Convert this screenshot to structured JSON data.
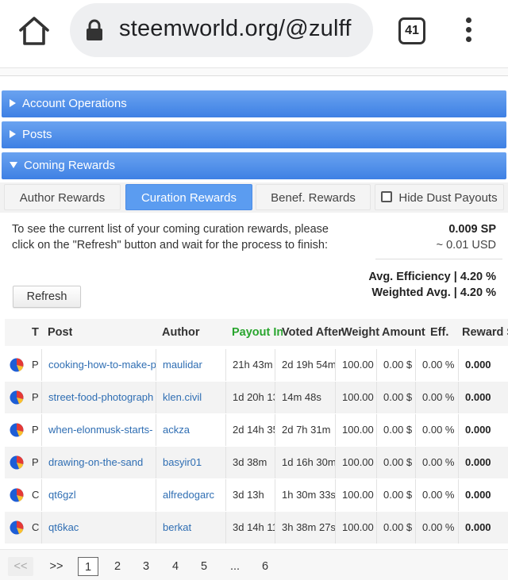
{
  "browser": {
    "url": "steemworld.org/@zulff",
    "tab_count": "41"
  },
  "sections": {
    "account_operations": "Account Operations",
    "posts": "Posts",
    "coming_rewards": "Coming Rewards"
  },
  "tabs": {
    "author": "Author Rewards",
    "curation": "Curation Rewards",
    "benef": "Benef. Rewards",
    "hide_dust": "Hide Dust Payouts"
  },
  "info": {
    "text": "To see the current list of your coming curation rewards, please click on the \"Refresh\" button and wait for the process to finish:",
    "sp": "0.009 SP",
    "usd": "~ 0.01 USD",
    "avg_eff": "Avg. Efficiency | 4.20 %",
    "weighted_avg": "Weighted Avg. | 4.20 %",
    "refresh_label": "Refresh"
  },
  "table": {
    "headers": {
      "t": "T",
      "post": "Post",
      "author": "Author",
      "payout_in": "Payout In",
      "voted_after": "Voted After",
      "weight": "Weight",
      "amount": "Amount",
      "eff": "Eff.",
      "reward": "Reward S"
    },
    "rows": [
      {
        "t": "P",
        "post": "cooking-how-to-make-p",
        "author": "maulidar",
        "payout_in": "21h 43m",
        "voted_after": "2d 19h 54m",
        "weight": "100.00",
        "amount": "0.00 $",
        "eff": "0.00 %",
        "reward": "0.000"
      },
      {
        "t": "P",
        "post": "street-food-photograph",
        "author": "klen.civil",
        "payout_in": "1d 20h 13",
        "voted_after": "14m 48s",
        "weight": "100.00",
        "amount": "0.00 $",
        "eff": "0.00 %",
        "reward": "0.000"
      },
      {
        "t": "P",
        "post": "when-elonmusk-starts-",
        "author": "ackza",
        "payout_in": "2d 14h 35",
        "voted_after": "2d 7h 31m",
        "weight": "100.00",
        "amount": "0.00 $",
        "eff": "0.00 %",
        "reward": "0.000"
      },
      {
        "t": "P",
        "post": "drawing-on-the-sand",
        "author": "basyir01",
        "payout_in": "3d 38m",
        "voted_after": "1d 16h 30m",
        "weight": "100.00",
        "amount": "0.00 $",
        "eff": "0.00 %",
        "reward": "0.000"
      },
      {
        "t": "C",
        "post": "qt6gzl",
        "author": "alfredogarc",
        "payout_in": "3d 13h",
        "voted_after": "1h 30m 33s",
        "weight": "100.00",
        "amount": "0.00 $",
        "eff": "0.00 %",
        "reward": "0.000"
      },
      {
        "t": "C",
        "post": "qt6kac",
        "author": "berkat",
        "payout_in": "3d 14h 11",
        "voted_after": "3h 38m 27s",
        "weight": "100.00",
        "amount": "0.00 $",
        "eff": "0.00 %",
        "reward": "0.000"
      }
    ]
  },
  "pager": {
    "first": "<<",
    "next": ">>",
    "pages": [
      "1",
      "2",
      "3",
      "4",
      "5"
    ],
    "ellipsis": "...",
    "last": "6"
  },
  "colors": {
    "section_blue": "#3e80e4",
    "tab_active": "#5b9cf0",
    "payout_green": "#29a52e",
    "link_blue": "#2f6eb3"
  }
}
